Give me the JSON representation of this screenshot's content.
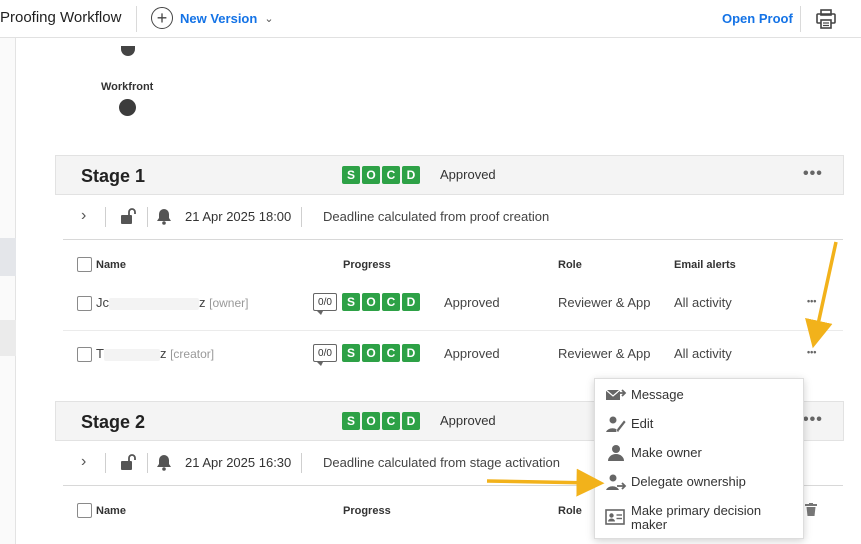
{
  "header": {
    "title": "Proofing Workflow",
    "new_version_label": "New Version",
    "open_proof_label": "Open Proof"
  },
  "workflow": {
    "node_label": "Workfront"
  },
  "stage1": {
    "title": "Stage 1",
    "badges": [
      "S",
      "O",
      "C",
      "D"
    ],
    "status": "Approved",
    "more": "•••",
    "date": "21 Apr 2025 18:00",
    "deadline_note": "Deadline calculated from proof creation",
    "columns": {
      "name": "Name",
      "progress": "Progress",
      "role": "Role",
      "email": "Email alerts"
    },
    "rows": [
      {
        "name_start": "Jc",
        "name_end": "z",
        "tag": "[owner]",
        "ratio": "0/0",
        "status": "Approved",
        "role": "Reviewer & App",
        "email": "All activity",
        "more": "•••"
      },
      {
        "name_start": "T",
        "name_end": "z",
        "tag": "[creator]",
        "ratio": "0/0",
        "status": "Approved",
        "role": "Reviewer & App",
        "email": "All activity",
        "more": "•••"
      }
    ]
  },
  "stage2": {
    "title": "Stage 2",
    "badges": [
      "S",
      "O",
      "C",
      "D"
    ],
    "status": "Approved",
    "more": "•••",
    "date": "21 Apr 2025 16:30",
    "deadline_note": "Deadline calculated from stage activation",
    "columns": {
      "name": "Name",
      "progress": "Progress",
      "role": "Role"
    }
  },
  "context_menu": {
    "items": [
      {
        "label": "Message",
        "icon": "message-icon"
      },
      {
        "label": "Edit",
        "icon": "edit-user-icon"
      },
      {
        "label": "Make owner",
        "icon": "user-icon"
      },
      {
        "label": "Delegate ownership",
        "icon": "delegate-user-icon"
      },
      {
        "label": "Make primary decision maker",
        "icon": "id-card-icon"
      }
    ]
  },
  "colors": {
    "accent": "#1473e6",
    "badge_green": "#2da146",
    "annotation_arrow": "#f2b21b"
  }
}
